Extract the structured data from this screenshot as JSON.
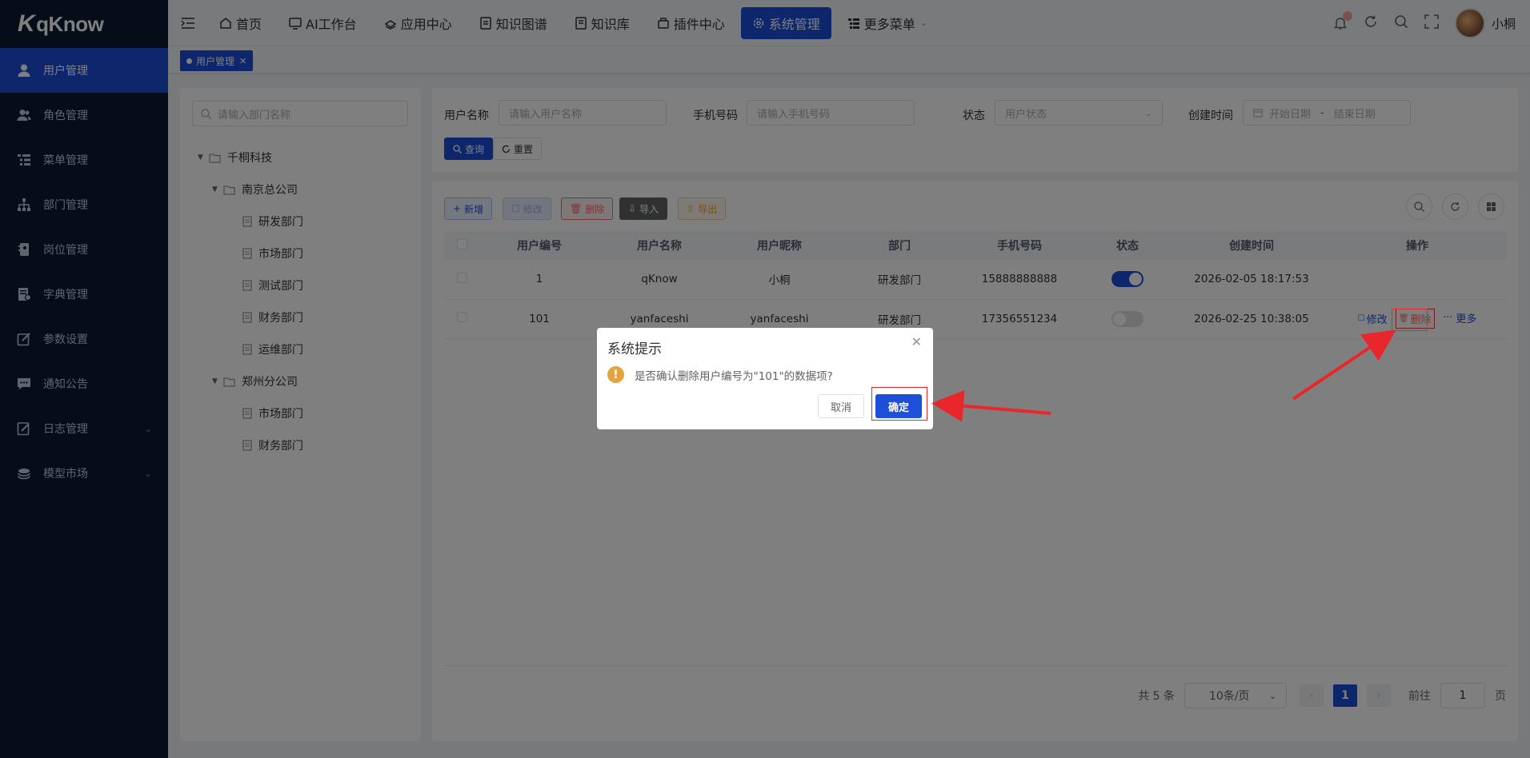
{
  "logo": {
    "mark": "K",
    "text": "qKnow"
  },
  "sidebar": {
    "items": [
      {
        "label": "用户管理",
        "icon": "user-icon",
        "active": true
      },
      {
        "label": "角色管理",
        "icon": "peoples-icon"
      },
      {
        "label": "菜单管理",
        "icon": "tree-table-icon"
      },
      {
        "label": "部门管理",
        "icon": "tree-icon"
      },
      {
        "label": "岗位管理",
        "icon": "post-icon"
      },
      {
        "label": "字典管理",
        "icon": "dict-icon"
      },
      {
        "label": "参数设置",
        "icon": "edit-icon"
      },
      {
        "label": "通知公告",
        "icon": "message-icon"
      },
      {
        "label": "日志管理",
        "icon": "log-icon",
        "expandable": true
      },
      {
        "label": "模型市场",
        "icon": "layers-icon",
        "expandable": true
      }
    ]
  },
  "topnav": {
    "items": [
      {
        "label": "首页",
        "icon": "home-icon"
      },
      {
        "label": "AI工作台",
        "icon": "monitor-icon"
      },
      {
        "label": "应用中心",
        "icon": "app-icon"
      },
      {
        "label": "知识图谱",
        "icon": "graph-icon"
      },
      {
        "label": "知识库",
        "icon": "book-icon"
      },
      {
        "label": "插件中心",
        "icon": "plugin-icon"
      },
      {
        "label": "系统管理",
        "icon": "gear-icon",
        "active": true
      },
      {
        "label": "更多菜单",
        "icon": "menu-icon",
        "dropdown": true
      }
    ],
    "username": "小桐"
  },
  "tags": {
    "active": "用户管理"
  },
  "dept": {
    "search_placeholder": "请输入部门名称",
    "tree": {
      "root": "千桐科技",
      "nanjing": "南京总公司",
      "nanjing_children": [
        "研发部门",
        "市场部门",
        "测试部门",
        "财务部门",
        "运维部门"
      ],
      "zhengzhou": "郑州分公司",
      "zhengzhou_children": [
        "市场部门",
        "财务部门"
      ]
    }
  },
  "search": {
    "username_label": "用户名称",
    "username_placeholder": "请输入用户名称",
    "phone_label": "手机号码",
    "phone_placeholder": "请输入手机号码",
    "status_label": "状态",
    "status_placeholder": "用户状态",
    "date_label": "创建时间",
    "date_start": "开始日期",
    "date_sep": "-",
    "date_end": "结束日期",
    "query": "查询",
    "reset": "重置"
  },
  "toolbar": {
    "add": "新增",
    "edit": "修改",
    "delete": "删除",
    "import": "导入",
    "export": "导出"
  },
  "table": {
    "headers": [
      "用户编号",
      "用户名称",
      "用户昵称",
      "部门",
      "手机号码",
      "状态",
      "创建时间",
      "操作"
    ],
    "rows": [
      {
        "id": "1",
        "name": "qKnow",
        "nickname": "小桐",
        "dept": "研发部门",
        "phone": "15888888888",
        "status": true,
        "created": "2026-02-05 18:17:53"
      },
      {
        "id": "101",
        "name": "yanfaceshi",
        "nickname": "yanfaceshi",
        "dept": "研发部门",
        "phone": "17356551234",
        "status": false,
        "created": "2026-02-25 10:38:05"
      }
    ],
    "ops": {
      "edit": "修改",
      "delete": "删除",
      "more": "更多"
    }
  },
  "pagination": {
    "total": "共 5 条",
    "page_size": "10条/页",
    "current": "1",
    "goto_label": "前往",
    "goto_value": "1",
    "page_suffix": "页"
  },
  "dialog": {
    "title": "系统提示",
    "message": "是否确认删除用户编号为\"101\"的数据项?",
    "cancel": "取消",
    "confirm": "确定"
  },
  "colors": {
    "primary": "#1d4fd8",
    "sidebar": "#0b1a33",
    "danger": "#f56c6c",
    "warning": "#e6a23c",
    "annotation": "#e8262b"
  }
}
